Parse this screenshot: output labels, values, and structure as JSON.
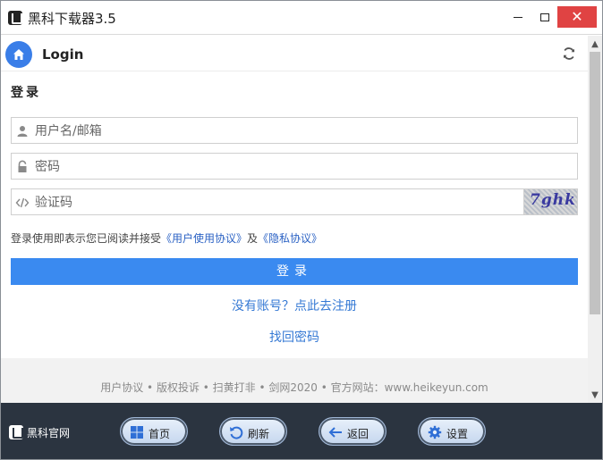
{
  "window": {
    "title": "黑科下载器3.5",
    "minimize_glyph": "",
    "maximize_glyph": "",
    "close_glyph": "✕"
  },
  "header": {
    "title": "Login",
    "home_icon": "home-icon",
    "refresh_icon": "refresh-icon"
  },
  "form": {
    "section_label": "登录",
    "username": {
      "placeholder": "用户名/邮箱",
      "value": ""
    },
    "password": {
      "placeholder": "密码",
      "value": ""
    },
    "captcha": {
      "placeholder": "验证码",
      "value": "",
      "image_text": "7ghk"
    },
    "agreement_prefix": "登录使用即表示您已阅读并接受",
    "agreement_terms": "《用户使用协议》",
    "agreement_and": "及",
    "agreement_privacy": "《隐私协议》",
    "submit_label": "登录",
    "register_link": "没有账号？点此去注册",
    "forgot_link": "找回密码"
  },
  "footer": {
    "text": "用户协议 • 版权投诉 • 扫黄打非 • 剑网2020 • 官方网站：www.heikeyun.com"
  },
  "bottombar": {
    "brand_label": "黑科官网",
    "buttons": [
      {
        "label": "首页",
        "icon": "windows-icon"
      },
      {
        "label": "刷新",
        "icon": "refresh-icon"
      },
      {
        "label": "返回",
        "icon": "back-arrow-icon"
      },
      {
        "label": "设置",
        "icon": "gear-icon"
      }
    ]
  },
  "colors": {
    "accent": "#3a8af0",
    "link": "#3579d4",
    "close_button": "#e04343",
    "bottombar": "#2b3440"
  }
}
